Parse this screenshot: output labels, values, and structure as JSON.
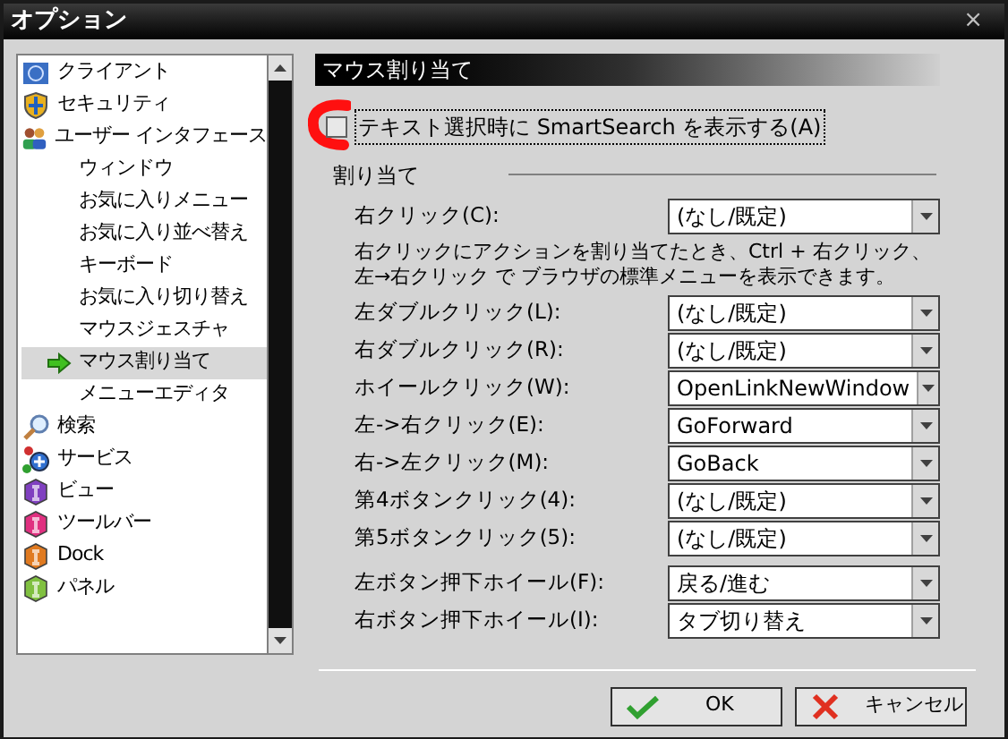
{
  "window": {
    "title": "オプション",
    "close": "×"
  },
  "sidebar": {
    "items": [
      {
        "label": "クライアント",
        "selected": false
      },
      {
        "label": "セキュリティ",
        "selected": false
      },
      {
        "label": "ユーザー インタフェース",
        "selected": false,
        "children": [
          {
            "label": "ウィンドウ",
            "selected": false
          },
          {
            "label": "お気に入りメニュー",
            "selected": false
          },
          {
            "label": "お気に入り並べ替え",
            "selected": false
          },
          {
            "label": "キーボード",
            "selected": false
          },
          {
            "label": "お気に入り切り替え",
            "selected": false
          },
          {
            "label": "マウスジェスチャ",
            "selected": false
          },
          {
            "label": "マウス割り当て",
            "selected": true
          },
          {
            "label": "メニューエディタ",
            "selected": false
          }
        ]
      },
      {
        "label": "検索",
        "selected": false
      },
      {
        "label": "サービス",
        "selected": false
      },
      {
        "label": "ビュー",
        "selected": false
      },
      {
        "label": "ツールバー",
        "selected": false
      },
      {
        "label": "Dock",
        "selected": false
      },
      {
        "label": "パネル",
        "selected": false
      }
    ]
  },
  "panel": {
    "title": "マウス割り当て",
    "checkbox": {
      "label": "テキスト選択時に SmartSearch を表示する(A)",
      "checked": false
    },
    "group": {
      "title": "割り当て",
      "rows": [
        {
          "kind": "select",
          "label": "右クリック(C):",
          "value": "(なし/既定)"
        },
        {
          "kind": "note",
          "text": "右クリックにアクションを割り当てたとき、Ctrl + 右クリック、左→右クリック で ブラウザの標準メニューを表示できます。"
        },
        {
          "kind": "select",
          "label": "左ダブルクリック(L):",
          "value": "(なし/既定)"
        },
        {
          "kind": "select",
          "label": "右ダブルクリック(R):",
          "value": "(なし/既定)"
        },
        {
          "kind": "select",
          "label": "ホイールクリック(W):",
          "value": "OpenLinkNewWindow"
        },
        {
          "kind": "select",
          "label": "左->右クリック(E):",
          "value": "GoForward"
        },
        {
          "kind": "select",
          "label": "右->左クリック(M):",
          "value": "GoBack"
        },
        {
          "kind": "select",
          "label": "第4ボタンクリック(4):",
          "value": "(なし/既定)"
        },
        {
          "kind": "select",
          "label": "第5ボタンクリック(5):",
          "value": "(なし/既定)"
        },
        {
          "kind": "gap"
        },
        {
          "kind": "select",
          "label": "左ボタン押下ホイール(F):",
          "value": "戻る/進む"
        },
        {
          "kind": "select",
          "label": "右ボタン押下ホイール(I):",
          "value": "タブ切り替え"
        }
      ]
    }
  },
  "buttons": [
    {
      "kind": "ok",
      "label": "OK"
    },
    {
      "kind": "cancel",
      "label": "キャンセル"
    }
  ]
}
